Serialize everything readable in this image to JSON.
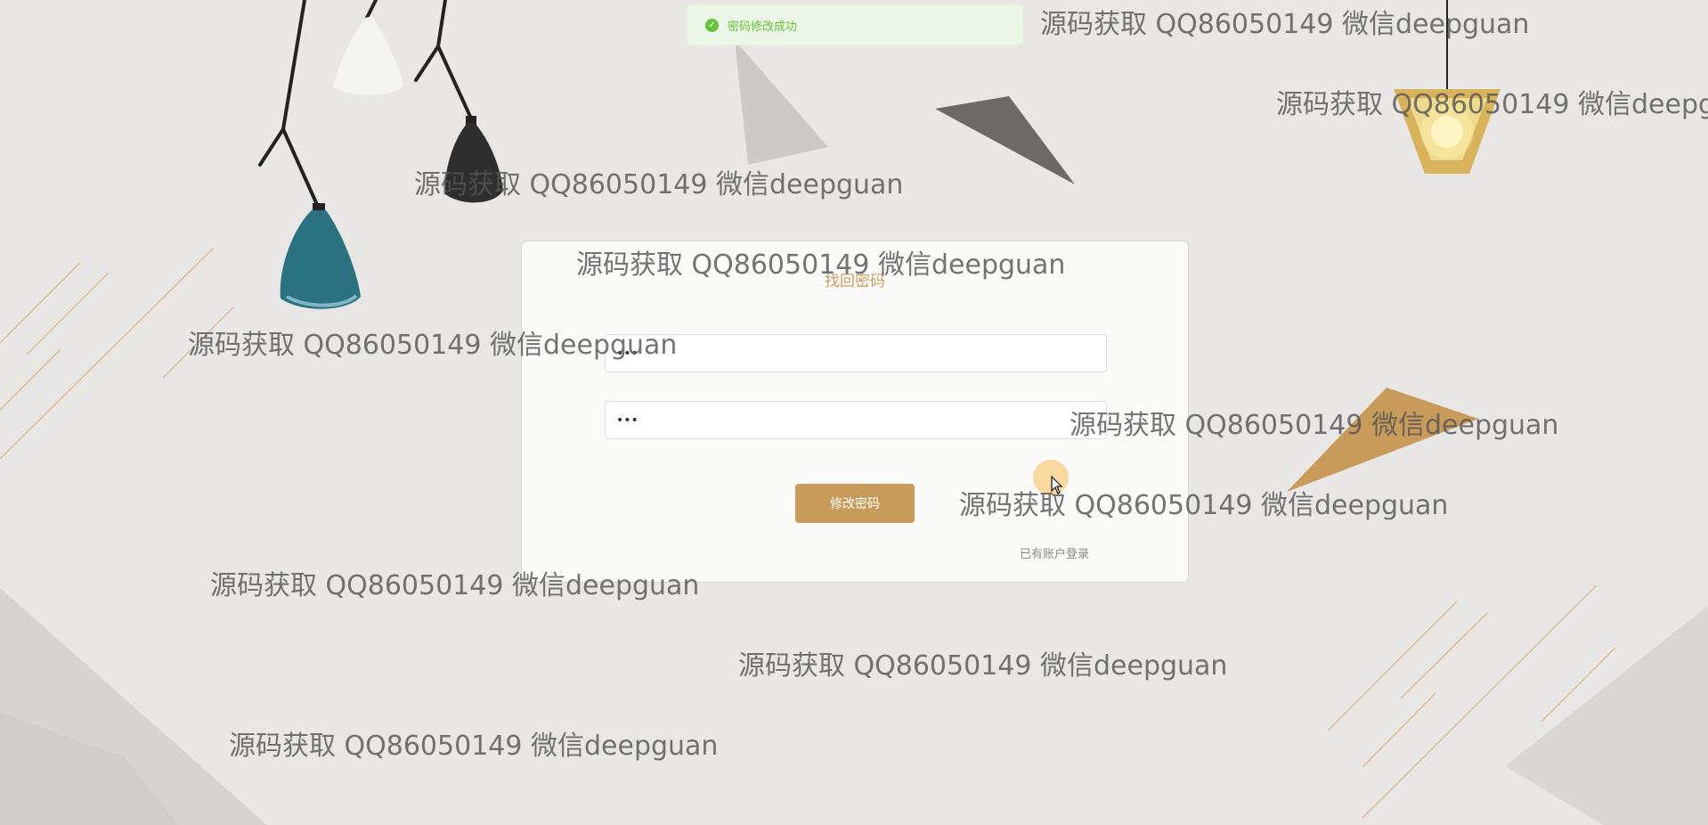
{
  "toast": {
    "icon": "check-circle-icon",
    "message": "密码修改成功",
    "color": "#67c23a"
  },
  "form": {
    "title": "找回密码",
    "password_value": "•••",
    "confirm_value": "•••",
    "submit_label": "修改密码",
    "login_link": "已有账户登录",
    "accent_color": "#c99b5a"
  },
  "watermark": {
    "text": "源码获取 QQ86050149 微信deepguan"
  }
}
